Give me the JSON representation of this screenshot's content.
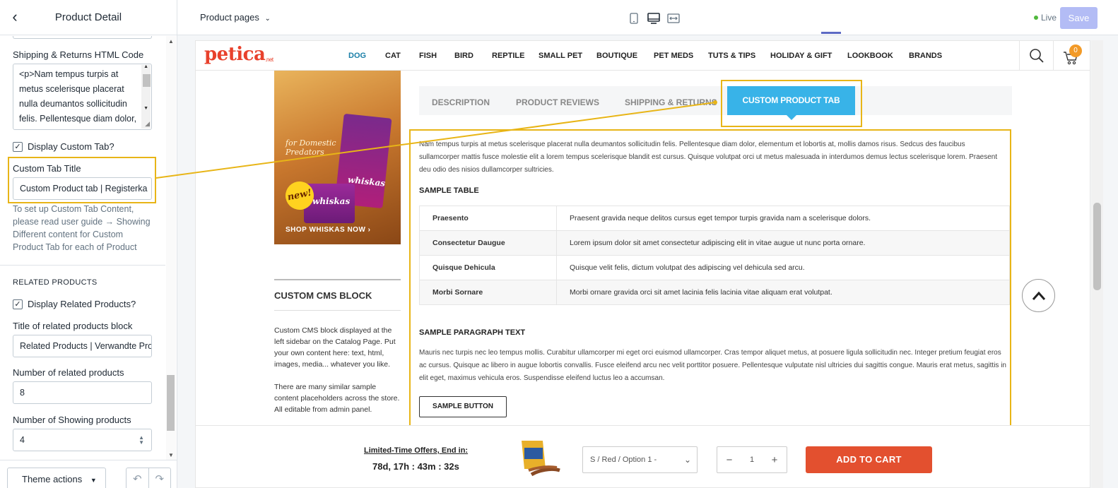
{
  "sidebar": {
    "title": "Product Detail",
    "shipping_label": "Shipping & Returns HTML Code",
    "shipping_code": "<p>Nam tempus turpis at\nmetus scelerisque placerat\nnulla deumantos sollicitudin\nfelis. Pellentesque diam dolor,",
    "display_custom_tab_label": "Display Custom Tab?",
    "display_custom_tab_checked": true,
    "custom_tab_title_label": "Custom Tab Title",
    "custom_tab_title_value": "Custom Product tab | Registerka",
    "help_text": "To set up Custom Tab Content, please read user guide → Showing Different content for Custom Product Tab for each of Product",
    "related_heading": "RELATED PRODUCTS",
    "display_related_label": "Display Related Products?",
    "display_related_checked": true,
    "related_title_label": "Title of related products block",
    "related_title_value": "Related Products | Verwandte Pro",
    "related_count_label": "Number of related products",
    "related_count_value": "8",
    "showing_count_label": "Number of Showing products",
    "showing_count_value": "4",
    "theme_actions_label": "Theme actions"
  },
  "topbar": {
    "page_selector": "Product pages",
    "live_label": "Live",
    "save_label": "Save",
    "selected_view": "desktop"
  },
  "store": {
    "logo": "petica",
    "logo_suffix": ".net",
    "nav": [
      "DOG",
      "CAT",
      "FISH",
      "BIRD",
      "REPTILE",
      "SMALL PET",
      "BOUTIQUE",
      "PET MEDS",
      "TUTS & TIPS",
      "HOLIDAY & GIFT",
      "LOOKBOOK",
      "BRANDS"
    ],
    "cart_count": "0",
    "banner": {
      "subtitle": "for Domestic Predators",
      "badge": "new!",
      "brand": "whiskas",
      "cta": "SHOP WHISKAS NOW ›"
    },
    "cms_title": "CUSTOM CMS BLOCK",
    "cms_p1": "Custom CMS block displayed at the left sidebar on the Catalog Page. Put your own content here: text, html, images, media... whatever you like.",
    "cms_p2": "There are many similar sample content placeholders across the store. All editable from admin panel.",
    "tabs": [
      "DESCRIPTION",
      "PRODUCT REVIEWS",
      "SHIPPING & RETURNS",
      "CUSTOM PRODUCT TAB"
    ],
    "description": "Nam tempus turpis at metus scelerisque placerat nulla deumantos sollicitudin felis. Pellentesque diam dolor, elementum et lobortis at, mollis damos risus. Sedcus des faucibus sullamcorper mattis fusce molestie elit a lorem tempus scelerisque blandit est cursus. Quisque volutpat orci ut metus malesuada in interdumos demus lectus scelerisque lorem. Praesent deu odio des nisios dullamcorper sultricies.",
    "sample_table_heading": "SAMPLE TABLE",
    "sample_table": [
      {
        "key": "Praesento",
        "value": "Praesent gravida neque delitos cursus eget tempor turpis gravida nam a scelerisque dolors."
      },
      {
        "key": "Consectetur Daugue",
        "value": "Lorem ipsum dolor sit amet consectetur adipiscing elit in vitae augue ut nunc porta ornare."
      },
      {
        "key": "Quisque Dehicula",
        "value": "Quisque velit felis, dictum volutpat des adipiscing vel dehicula sed arcu."
      },
      {
        "key": "Morbi Sornare",
        "value": "Morbi ornare gravida orci sit amet lacinia felis lacinia vitae aliquam erat volutpat."
      }
    ],
    "sample_paragraph_heading": "SAMPLE PARAGRAPH TEXT",
    "sample_paragraph": "Mauris nec turpis nec leo tempus mollis. Curabitur ullamcorper mi eget orci euismod ullamcorper. Cras tempor aliquet metus, at posuere ligula sollicitudin nec. Integer pretium feugiat eros ac cursus. Quisque ac libero in augue lobortis convallis. Fusce eleifend arcu nec velit porttitor posuere. Pellentesque vulputate nisl ultricies dui sagittis congue. Mauris erat metus, sagittis in elit eget, maximus vehicula eros. Suspendisse eleifend luctus leo a accumsan.",
    "sample_button": "SAMPLE BUTTON",
    "offer_label": "Limited-Time Offers, End in:",
    "offer_time": "78d, 17h : 43m : 32s",
    "variant": "S / Red / Option 1 -",
    "quantity": "1",
    "add_to_cart": "ADD TO CART"
  },
  "colors": {
    "highlight": "#e8b517",
    "tab_active": "#38b3e8",
    "add_to_cart": "#e3502f",
    "save_button": "#b3bcf5",
    "logo": "#e8412c"
  }
}
